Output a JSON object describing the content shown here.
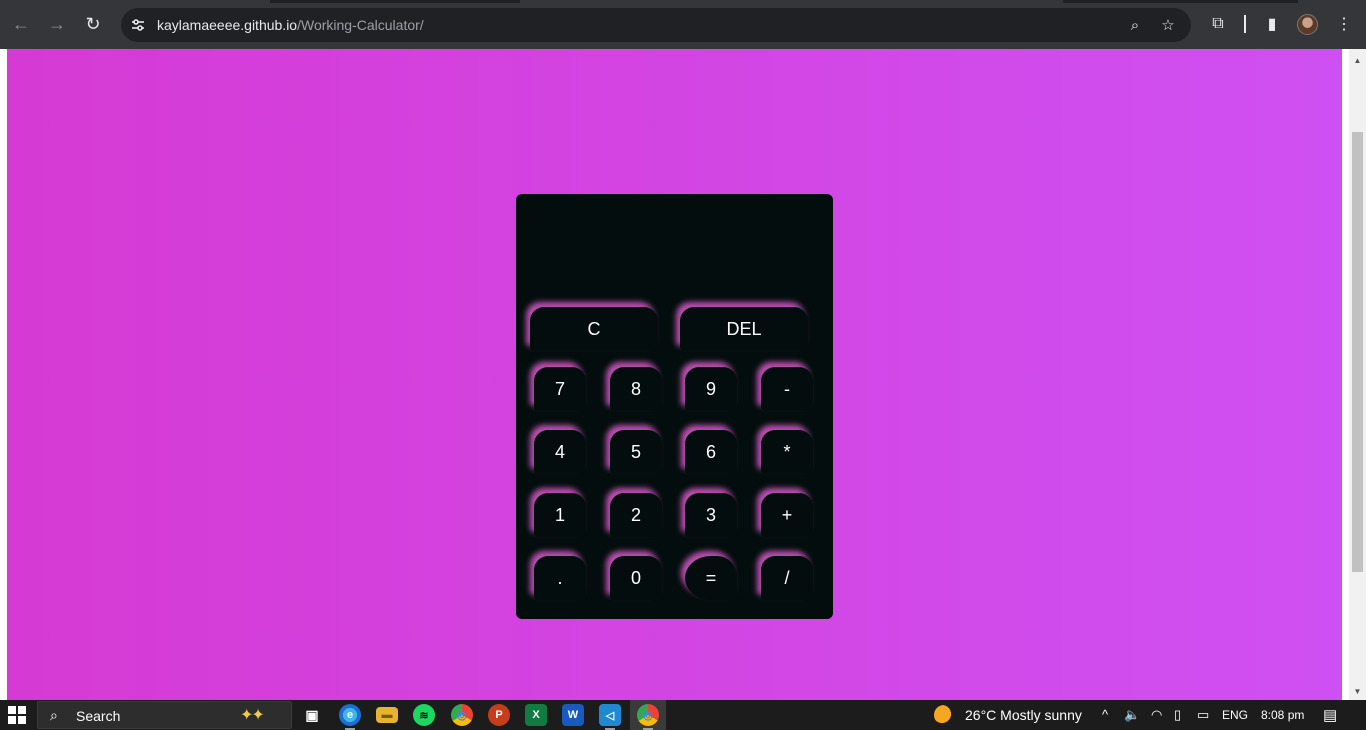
{
  "browser": {
    "url_host": "kaylamaeeee.github.io",
    "url_path": "/Working-Calculator/",
    "back_icon": "←",
    "forward_icon": "→",
    "reload_icon": "↻",
    "zoom_icon": "⌕",
    "star_icon": "☆",
    "extensions_icon": "⧉",
    "sidepanel_icon": "▮",
    "menu_icon": "⋮"
  },
  "calculator": {
    "display_value": "",
    "keys": {
      "clear": "C",
      "delete": "DEL",
      "seven": "7",
      "eight": "8",
      "nine": "9",
      "minus": "-",
      "four": "4",
      "five": "5",
      "six": "6",
      "multiply": "*",
      "one": "1",
      "two": "2",
      "three": "3",
      "plus": "+",
      "decimal": ".",
      "zero": "0",
      "equals": "=",
      "divide": "/"
    }
  },
  "taskbar": {
    "search_label": "Search",
    "weather": "26°C  Mostly sunny",
    "language": "ENG",
    "time": "8:08 pm",
    "apps": {
      "task_view": "▣",
      "edge": "e",
      "files": "▬",
      "spotify": "≋",
      "chrome": "◎",
      "powerpoint": "P",
      "excel": "X",
      "word": "W",
      "vscode": "◁",
      "chrome_active": "◎"
    },
    "tray_chevron": "^",
    "volume_icon": "🔈",
    "wifi_icon": "◠",
    "battery_icon": "▭",
    "notification_icon": "▤"
  },
  "colors": {
    "page_gradient_start": "#d63ad4",
    "page_gradient_end": "#cf50f2",
    "calculator_bg": "#030d0d",
    "key_glow": "#dc5acd"
  }
}
